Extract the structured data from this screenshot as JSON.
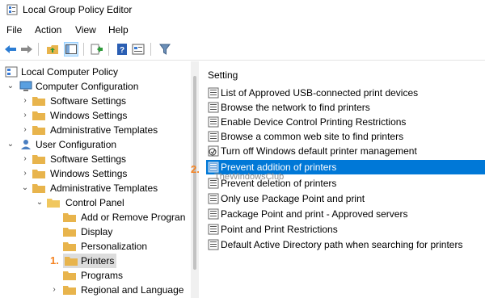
{
  "window": {
    "title": "Local Group Policy Editor"
  },
  "menu": [
    "File",
    "Action",
    "View",
    "Help"
  ],
  "toolbar": [
    "back-arrow-icon",
    "forward-arrow-icon",
    "folder-up-icon",
    "show-hide-tree-icon",
    "export-list-icon",
    "help-icon",
    "properties-icon",
    "filter-icon"
  ],
  "tree": {
    "root": "Local Computer Policy",
    "computer_config": "Computer Configuration",
    "cc_software": "Software Settings",
    "cc_windows": "Windows Settings",
    "cc_admin": "Administrative Templates",
    "user_config": "User Configuration",
    "uc_software": "Software Settings",
    "uc_windows": "Windows Settings",
    "uc_admin": "Administrative Templates",
    "control_panel": "Control Panel",
    "add_remove": "Add or Remove Progran",
    "display": "Display",
    "personalization": "Personalization",
    "printers": "Printers",
    "programs": "Programs",
    "regional": "Regional and Language"
  },
  "annotations": {
    "step1": "1.",
    "step2": "2."
  },
  "list": {
    "header": "Setting",
    "items": [
      "List of Approved USB-connected print devices",
      "Browse the network to find printers",
      "Enable Device Control Printing Restrictions",
      "Browse a common web site to find printers",
      "Turn off Windows default printer management",
      "Prevent addition of printers",
      "Prevent deletion of printers",
      "Only use Package Point and print",
      "Package Point and print - Approved servers",
      "Point and Print Restrictions",
      "Default Active Directory path when searching for printers"
    ],
    "selected_index": 5
  },
  "watermark": "TheWindowsClub",
  "colors": {
    "selection": "#0078d7",
    "annotation": "#f58220",
    "folder": "#e8b44c"
  }
}
